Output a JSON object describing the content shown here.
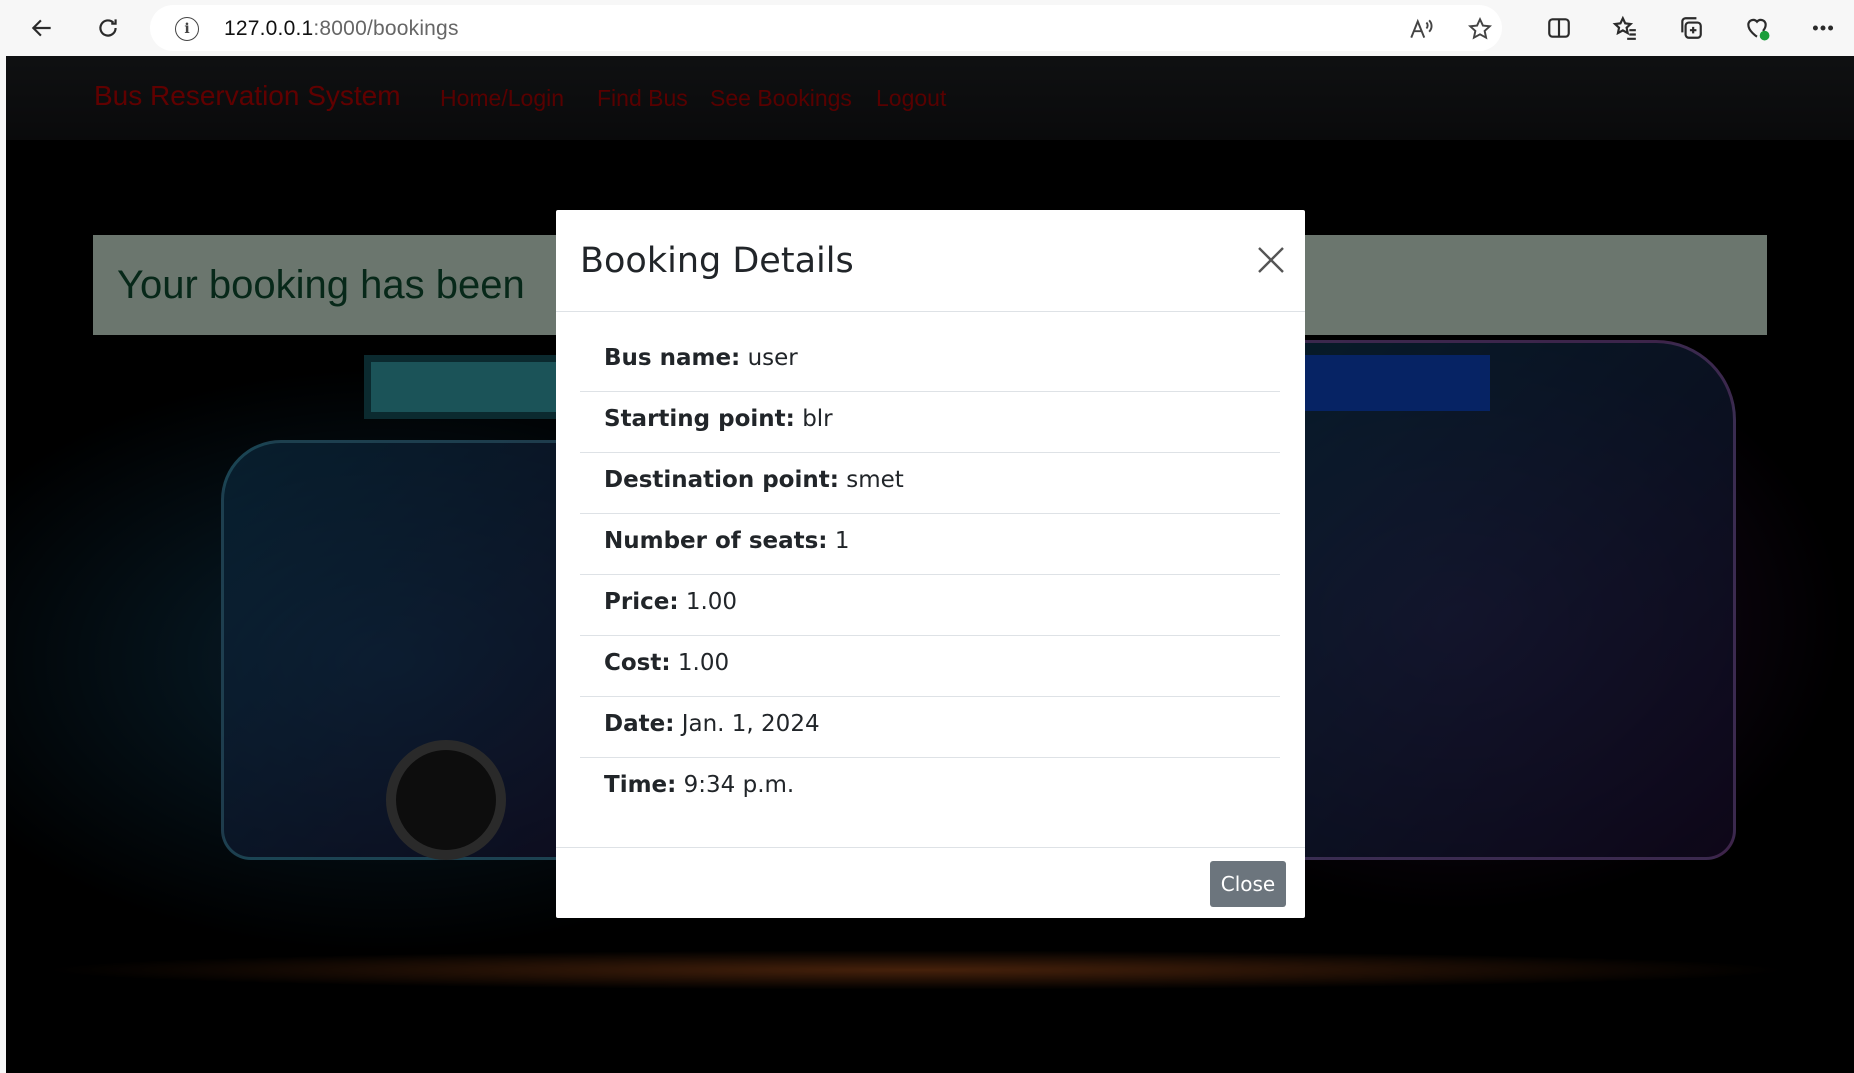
{
  "browser": {
    "url_host": "127.0.0.1",
    "url_path": ":8000/bookings",
    "icons": [
      "back-icon",
      "refresh-icon",
      "info-icon",
      "read-aloud-icon",
      "favorite-star-icon",
      "split-screen-icon",
      "favorites-icon",
      "collections-icon",
      "browser-essentials-icon",
      "more-icon"
    ]
  },
  "site": {
    "brand": "Bus Reservation System",
    "nav": [
      "Home/Login",
      "Find Bus",
      "See Bookings",
      "Logout"
    ],
    "alert_text": "Your booking has been"
  },
  "modal": {
    "title": "Booking Details",
    "details": [
      {
        "label": "Bus name:",
        "value": "user"
      },
      {
        "label": "Starting point:",
        "value": "blr"
      },
      {
        "label": "Destination point:",
        "value": "smet"
      },
      {
        "label": "Number of seats:",
        "value": "1"
      },
      {
        "label": "Price:",
        "value": "1.00"
      },
      {
        "label": "Cost:",
        "value": "1.00"
      },
      {
        "label": "Date:",
        "value": "Jan. 1, 2024"
      },
      {
        "label": "Time:",
        "value": "9:34 p.m."
      }
    ],
    "close_label": "Close"
  },
  "colors": {
    "brand_red": "#c00000",
    "alert_bg": "#d6ecdd",
    "alert_text": "#0f5132",
    "close_button": "#6c757d"
  }
}
